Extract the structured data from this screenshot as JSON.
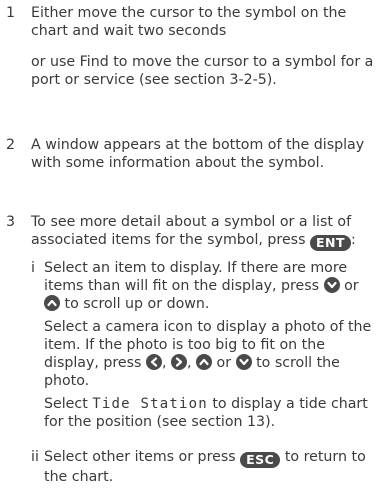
{
  "steps": [
    {
      "num": "1",
      "lines": [
        "Either move the cursor to the symbol on the chart and wait two seconds",
        "or use Find to move the cursor to a symbol for a port or service (see section 3-2-5)."
      ]
    },
    {
      "num": "2",
      "text": "A window appears at the bottom of the display with some information about the symbol."
    },
    {
      "num": "3",
      "text_before_key": "To see more detail about a symbol or a list of associated items for the symbol, press",
      "key": "ENT",
      "after_key": ":",
      "substeps": [
        {
          "label": "i",
          "p1_start": "Select an item to display. If there are more items than will fit on the display, press",
          "p1_mid": "or",
          "p1_end": "to scroll up or down.",
          "p2_start": "Select a camera icon to display a photo of the item. If the photo is too big to fit on the display, press",
          "p2_sep1": ",",
          "p2_sep2": ",",
          "p2_or": "or",
          "p2_end": "to scroll the photo.",
          "p3_start": "Select",
          "p3_code": "Tide Station",
          "p3_end": "to display a tide chart for the position (see section 13)."
        },
        {
          "label": "ii",
          "text_before_key": "Select other items or press",
          "key": "ESC",
          "text_after_key": "to return to the chart."
        }
      ]
    }
  ],
  "colors": {
    "text": "#3a3a3a",
    "key_bg": "#4a4a4a",
    "key_fg": "#ffffff"
  },
  "icons": [
    "down-arrow-key-icon",
    "up-arrow-key-icon",
    "left-arrow-key-icon",
    "right-arrow-key-icon"
  ]
}
